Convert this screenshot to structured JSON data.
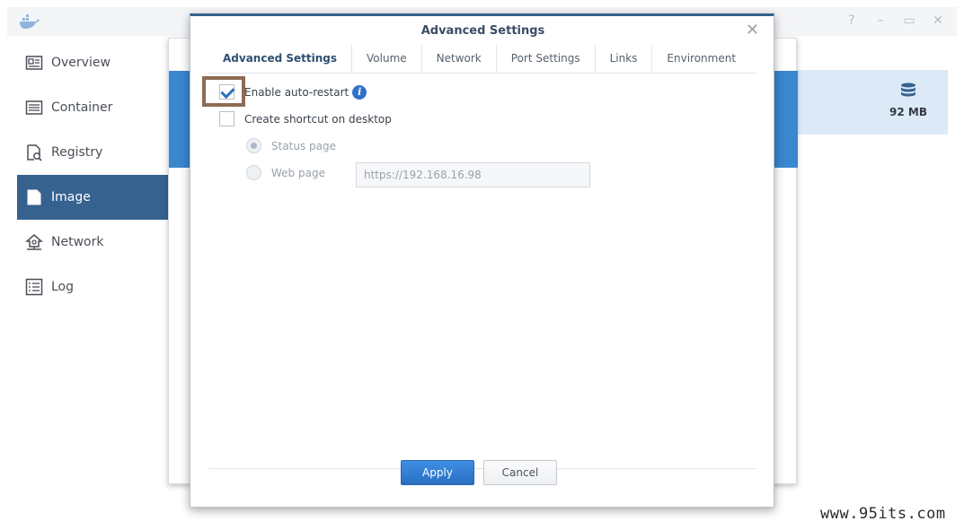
{
  "sidebar": {
    "items": [
      {
        "label": "Overview",
        "icon": "overview-icon"
      },
      {
        "label": "Container",
        "icon": "container-icon"
      },
      {
        "label": "Registry",
        "icon": "registry-icon"
      },
      {
        "label": "Image",
        "icon": "image-icon",
        "active": true
      },
      {
        "label": "Network",
        "icon": "network-icon"
      },
      {
        "label": "Log",
        "icon": "log-icon"
      }
    ]
  },
  "background": {
    "size_value": "92 MB"
  },
  "dialog": {
    "title": "Advanced Settings",
    "tabs": [
      {
        "label": "Advanced Settings",
        "active": true
      },
      {
        "label": "Volume"
      },
      {
        "label": "Network"
      },
      {
        "label": "Port Settings"
      },
      {
        "label": "Links"
      },
      {
        "label": "Environment"
      }
    ],
    "auto_restart": {
      "label": "Enable auto-restart",
      "checked": true
    },
    "shortcut": {
      "label": "Create shortcut on desktop",
      "checked": false
    },
    "status_page": {
      "label": "Status page",
      "selected": true
    },
    "web_page": {
      "label": "Web page",
      "selected": false
    },
    "url_value": "https://192.168.16.98",
    "apply_label": "Apply",
    "cancel_label": "Cancel"
  },
  "watermark": "www.95its.com",
  "colors": {
    "accent": "#35628f",
    "primary_button": "#2f7bd5",
    "highlight_box": "#8f6b53"
  }
}
